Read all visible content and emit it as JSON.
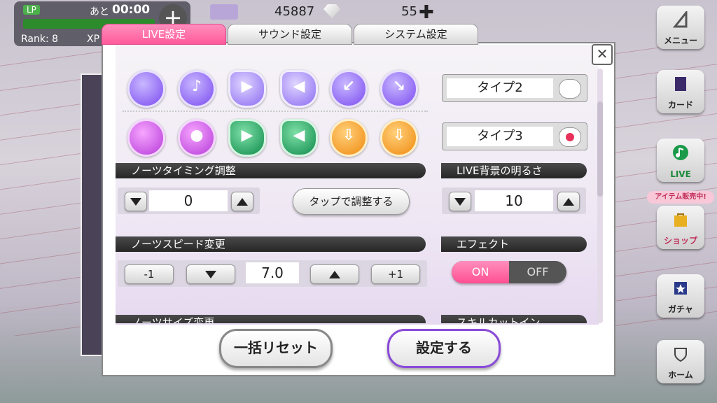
{
  "hud": {
    "lp_label": "LP",
    "ato_label": "あと",
    "lp_timer": "00:00",
    "rank": "Rank: 8",
    "xp_label": "XP",
    "money": "45887",
    "gems": "55"
  },
  "side_menu": {
    "menu": "メニュー",
    "card": "カード",
    "live": "LIVE",
    "promo": "アイテム販売中!",
    "shop": "ショップ",
    "gacha": "ガチャ",
    "home": "ホーム"
  },
  "tabs": [
    {
      "label": "LIVE設定",
      "active": true
    },
    {
      "label": "サウンド設定",
      "active": false
    },
    {
      "label": "システム設定",
      "active": false
    }
  ],
  "dialog": {
    "close_glyph": "✕",
    "type_options": [
      {
        "label": "タイプ2",
        "selected": false
      },
      {
        "label": "タイプ3",
        "selected": true
      }
    ],
    "note_timing": {
      "header": "ノーツタイミング調整",
      "value": "0",
      "tap_adjust_label": "タップで調整する"
    },
    "live_bg_brightness": {
      "header": "LIVE背景の明るさ",
      "value": "10"
    },
    "note_speed": {
      "header": "ノーツスピード変更",
      "value": "7.0",
      "minus_one": "-1",
      "plus_one": "+1"
    },
    "effect": {
      "header": "エフェクト",
      "on_label": "ON",
      "off_label": "OFF",
      "state": "ON"
    },
    "note_size": {
      "header": "ノーツサイズ変更"
    },
    "skill_cutin": {
      "header": "スキルカットイン"
    },
    "reset_label": "一括リセット",
    "apply_label": "設定する"
  },
  "colors": {
    "accent_pink": "#ff5a9a",
    "apply_border": "#8a4ad8",
    "header_bg": "#2a2a2a"
  }
}
